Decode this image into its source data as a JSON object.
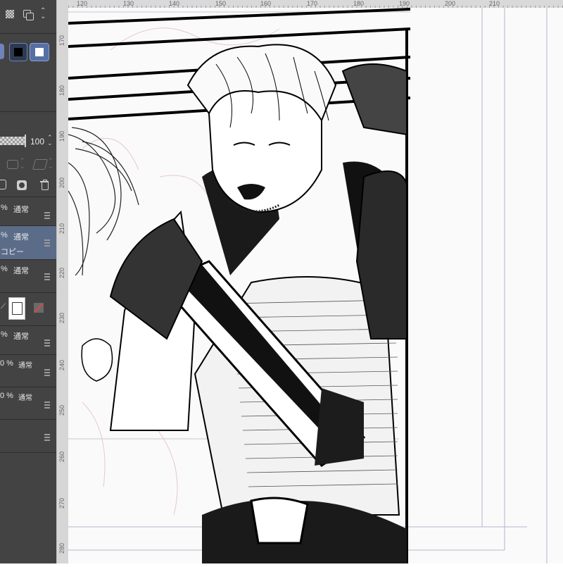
{
  "app": {
    "left_panel": {
      "opacity_value": "100",
      "layers": [
        {
          "percent": "%",
          "blend": "通常",
          "name": ""
        },
        {
          "percent": "%",
          "blend": "通常",
          "name": "コピー",
          "selected": true
        },
        {
          "percent": "%",
          "blend": "通常",
          "name": ""
        },
        {
          "percent": "%",
          "blend": "通常",
          "name": ""
        },
        {
          "percent": "0 %",
          "blend": "通常",
          "name": ""
        },
        {
          "percent": "0 %",
          "blend": "通常",
          "name": ""
        }
      ]
    },
    "ruler": {
      "top_ticks": [
        "120",
        "130",
        "140",
        "150",
        "160",
        "170",
        "180",
        "190",
        "200",
        "210"
      ],
      "left_ticks": [
        "170",
        "180",
        "190",
        "200",
        "210",
        "220",
        "230",
        "240",
        "250",
        "260",
        "270",
        "280"
      ]
    },
    "colors": {
      "panel_bg": "#434343",
      "selected_layer": "#5d6f8c",
      "accent": "#4a74c9"
    }
  }
}
